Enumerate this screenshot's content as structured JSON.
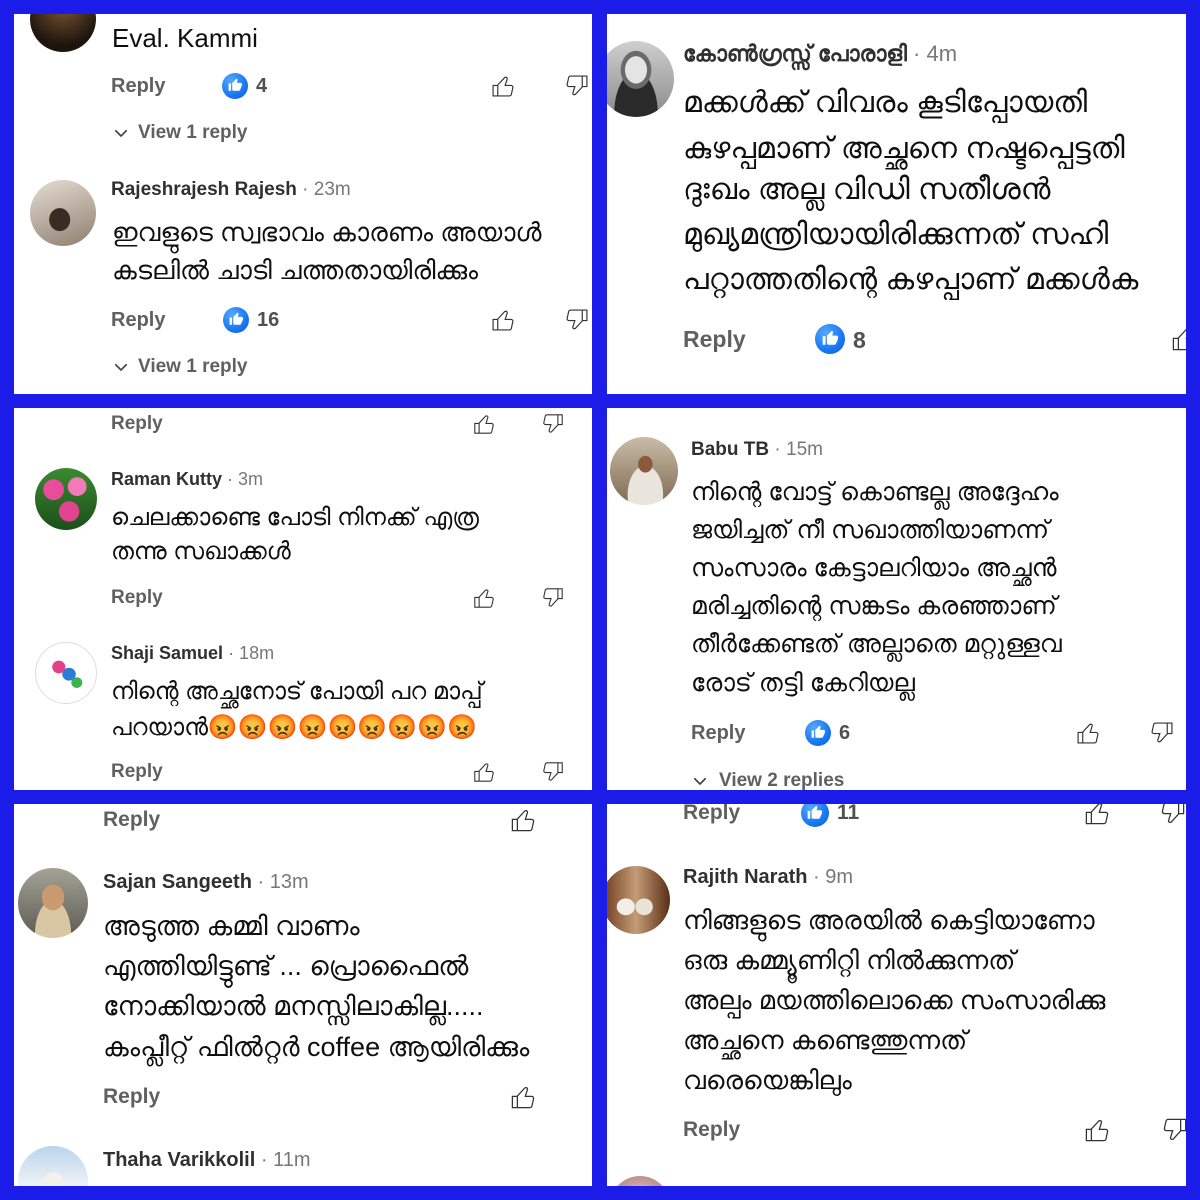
{
  "collage": {
    "border_color": "#1c1ce8",
    "panel_background": "#ffffff"
  },
  "colors": {
    "like_badge": "#1877f2",
    "author": "#303030",
    "timestamp": "#777777",
    "action": "#606060",
    "body": "#0f0f0f"
  },
  "icons": {
    "like": "thumbs-up-icon",
    "dislike": "thumbs-down-icon",
    "reaction": "like-reaction-icon",
    "expand": "chevron-down-icon"
  },
  "panels": [
    {
      "items": [
        {
          "body": [
            "Eval. Kammi"
          ],
          "reply": "Reply",
          "likes": "4",
          "view_replies": "View 1 reply"
        },
        {
          "author": "Rajeshrajesh Rajesh",
          "time": "· 23m",
          "body": [
            "ഇവളുടെ സ്വഭാവം കാരണം അയാൾ",
            "കടലിൽ ചാടി ചത്തതായിരിക്കും"
          ],
          "reply": "Reply",
          "likes": "16",
          "view_replies": "View 1 reply"
        }
      ]
    },
    {
      "items": [
        {
          "author": "കോൺഗ്രസ്സ് പോരാളി",
          "time": "· 4m",
          "body": [
            "മക്കൾക്ക് വിവരം കൂടിപ്പോയതി",
            "കുഴപ്പമാണ് അച്ഛനെ നഷ്ടപ്പെട്ടതി",
            "ദുഃഖം അല്ല വിഡി സതീശൻ",
            "മുഖ്യമന്ത്രിയായിരിക്കുന്നത് സഹി",
            "പറ്റാത്തതിന്റെ കഴപ്പാണ് മക്കൾക"
          ],
          "reply": "Reply",
          "likes": "8"
        }
      ]
    },
    {
      "items": [
        {
          "reply": "Reply"
        },
        {
          "author": "Raman Kutty",
          "time": "· 3m",
          "body": [
            "ചെലക്കാണ്ടെ പോടി നിനക്ക് എത്ര",
            "തന്നു സഖാക്കൾ"
          ],
          "reply": "Reply"
        },
        {
          "author": "Shaji Samuel",
          "time": "· 18m",
          "body": [
            "നിന്റെ അച്ഛനോട് പോയി പറ മാപ്പ്",
            "പറയാൻ😡😡😡😡😡😡😡😡😡"
          ],
          "reply": "Reply"
        }
      ]
    },
    {
      "items": [
        {
          "author": "Babu TB",
          "time": "· 15m",
          "body": [
            "നിന്റെ വോട്ട് കൊണ്ടല്ല അദ്ദേഹം",
            "ജയിച്ചത് നീ സഖാത്തിയാണന്ന്",
            "സംസാരം കേട്ടാലറിയാം അച്ഛൻ",
            "മരിച്ചതിന്റെ സങ്കടം കരഞ്ഞാണ്",
            "തീർക്കേണ്ടത് അല്ലാതെ മറ്റുള്ളവ",
            "രോട് തട്ടി കേറിയല്ല"
          ],
          "reply": "Reply",
          "likes": "6",
          "view_replies": "View 2 replies"
        }
      ]
    },
    {
      "items": [
        {
          "reply": "Reply"
        },
        {
          "author": "Sajan Sangeeth",
          "time": "· 13m",
          "body": [
            "അടുത്ത കമ്മി വാണം",
            "എത്തിയിട്ടുണ്ട്  ... പ്രൊഫൈൽ",
            "നോക്കിയാൽ മനസ്സിലാകില്ല.....",
            "കംപ്ലീറ്റ് ഫിൽറ്റർ coffee ആയിരിക്കും"
          ],
          "reply": "Reply"
        },
        {
          "author": "Thaha Varikkolil",
          "time": "· 11m"
        }
      ]
    },
    {
      "items": [
        {
          "reply": "Reply",
          "likes": "11"
        },
        {
          "author": "Rajith Narath",
          "time": "· 9m",
          "body": [
            "നിങ്ങളുടെ അരയിൽ കെട്ടിയാണോ",
            "ഒരു കമ്മ്യൂണിറ്റി നിൽക്കുന്നത്",
            "അല്പം മയത്തിലൊക്കെ സംസാരിക്കു",
            "അച്ഛനെ കണ്ടെത്തുന്നത്",
            "വരെയെങ്കിലും"
          ],
          "reply": "Reply"
        }
      ]
    }
  ]
}
